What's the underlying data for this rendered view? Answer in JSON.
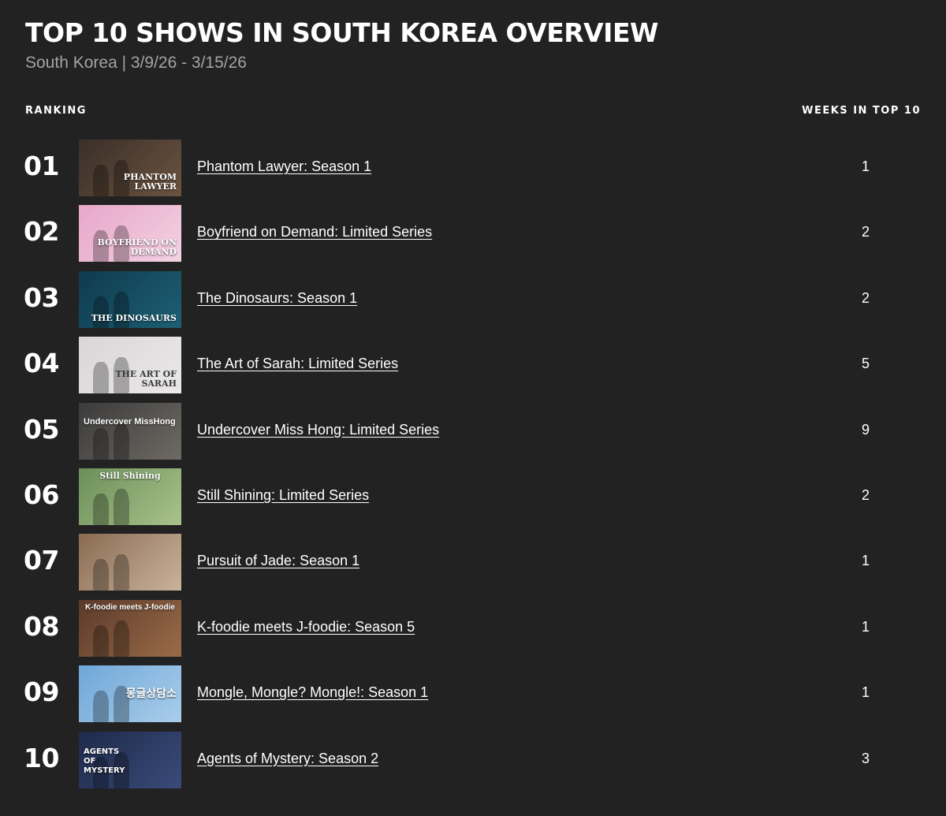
{
  "page": {
    "title": "TOP 10 SHOWS IN SOUTH KOREA OVERVIEW",
    "subtitle": "South Korea | 3/9/26 - 3/15/26"
  },
  "table": {
    "header_ranking": "RANKING",
    "header_weeks": "WEEKS IN TOP 10",
    "rows": [
      {
        "rank": "01",
        "title": "Phantom Lawyer: Season 1",
        "weeks": "1",
        "thumb_label": "PHANTOM LAWYER",
        "thumb_colors": [
          "#3a2f28",
          "#6b5340"
        ]
      },
      {
        "rank": "02",
        "title": "Boyfriend on Demand: Limited Series",
        "weeks": "2",
        "thumb_label": "BOYFRIEND ON DEMAND",
        "thumb_colors": [
          "#e7a6c9",
          "#f3d2e3"
        ]
      },
      {
        "rank": "03",
        "title": "The Dinosaurs: Season 1",
        "weeks": "2",
        "thumb_label": "THE DINOSAURS",
        "thumb_colors": [
          "#0f3a4d",
          "#1d5f74"
        ]
      },
      {
        "rank": "04",
        "title": "The Art of Sarah: Limited Series",
        "weeks": "5",
        "thumb_label": "THE ART OF SARAH",
        "thumb_colors": [
          "#d8d6d6",
          "#ebe9e8"
        ]
      },
      {
        "rank": "05",
        "title": "Undercover Miss Hong: Limited Series",
        "weeks": "9",
        "thumb_label": "Undercover MissHong",
        "thumb_colors": [
          "#3b3b3b",
          "#6e6a64"
        ]
      },
      {
        "rank": "06",
        "title": "Still Shining: Limited Series",
        "weeks": "2",
        "thumb_label": "Still Shining",
        "thumb_colors": [
          "#6b8f5a",
          "#a9c28a"
        ]
      },
      {
        "rank": "07",
        "title": "Pursuit of Jade: Season 1",
        "weeks": "1",
        "thumb_label": "",
        "thumb_colors": [
          "#8a6b52",
          "#c9b39a"
        ]
      },
      {
        "rank": "08",
        "title": "K-foodie meets J-foodie: Season 5",
        "weeks": "1",
        "thumb_label": "K-foodie meets J-foodie",
        "thumb_colors": [
          "#5a3a2a",
          "#9b6b48"
        ]
      },
      {
        "rank": "09",
        "title": "Mongle, Mongle? Mongle!: Season 1",
        "weeks": "1",
        "thumb_label": "몽글상담소",
        "thumb_colors": [
          "#6fa7d8",
          "#a9cdea"
        ]
      },
      {
        "rank": "10",
        "title": "Agents of Mystery: Season 2",
        "weeks": "3",
        "thumb_label": "AGENTS OF MYSTERY",
        "thumb_colors": [
          "#1e2a4a",
          "#3a4b7a"
        ]
      }
    ]
  }
}
